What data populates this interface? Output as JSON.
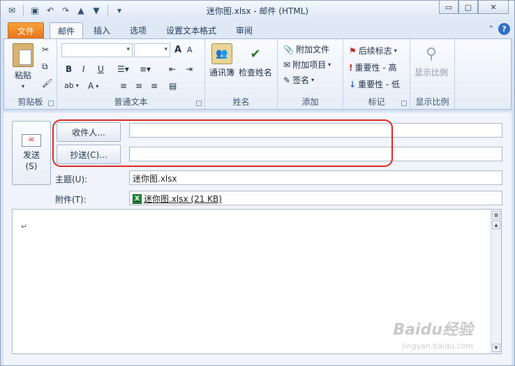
{
  "window": {
    "title": "迷你图.xlsx - 邮件 (HTML)",
    "minimize": "▭",
    "maximize": "▢",
    "close": "✕"
  },
  "tabs": [
    {
      "label": "文件"
    },
    {
      "label": "邮件"
    },
    {
      "label": "插入"
    },
    {
      "label": "选项"
    },
    {
      "label": "设置文本格式"
    },
    {
      "label": "审阅"
    }
  ],
  "ribbon": {
    "clipboard": {
      "label": "剪贴板",
      "paste": "粘贴"
    },
    "basic_text": {
      "label": "普通文本",
      "font_grow": "A",
      "font_shrink": "A",
      "bold": "B",
      "italic": "I",
      "underline": "U",
      "highlight": "ab",
      "font_color": "A"
    },
    "names": {
      "label": "姓名",
      "address_book": "通讯簿",
      "check_names": "检查姓名"
    },
    "include": {
      "label": "添加",
      "attach_file": "附加文件",
      "attach_item": "附加项目",
      "signature": "签名"
    },
    "tags": {
      "label": "标记",
      "follow_up": "后续标志",
      "high_importance": "重要性 - 高",
      "low_importance": "重要性 - 低"
    },
    "zoom": {
      "label": "显示比例",
      "zoom_button": "显示比例"
    }
  },
  "form": {
    "send_label": "发送",
    "send_shortcut": "(S)",
    "to_button": "收件人...",
    "cc_button": "抄送(C)...",
    "to_value": "",
    "cc_value": "",
    "subject_label": "主题(U):",
    "subject_value": "迷你图.xlsx",
    "attach_label": "附件(T):",
    "attachment": "迷你图.xlsx (21 KB)",
    "body_mark": "↵"
  },
  "watermark": {
    "text": "Baidu经验",
    "url": "jingyan.baidu.com"
  }
}
